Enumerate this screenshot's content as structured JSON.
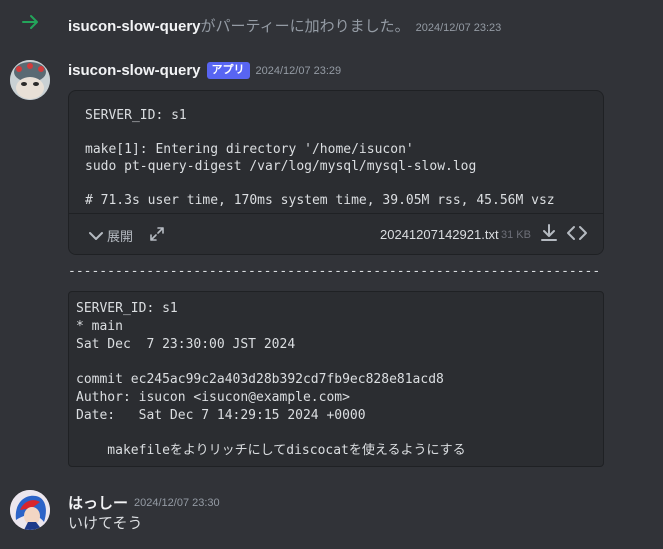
{
  "join_message": {
    "username": "isucon-slow-query",
    "text": "がパーティーに加わりました。",
    "timestamp": "2024/12/07 23:23"
  },
  "message1": {
    "author": "isucon-slow-query",
    "badge": "アプリ",
    "timestamp": "2024/12/07 23:29",
    "attachment": {
      "preview": "SERVER_ID: s1\n\nmake[1]: Entering directory '/home/isucon'\nsudo pt-query-digest /var/log/mysql/mysql-slow.log\n\n# 71.3s user time, 170ms system time, 39.05M rss, 45.56M vsz",
      "expand_label": "展開",
      "file_name": "20241207142921.txt",
      "file_size": "31 KB"
    },
    "separator": "--------------------------------------------------------------------",
    "code_block": "SERVER_ID: s1\n* main\nSat Dec  7 23:30:00 JST 2024\n\ncommit ec245ac99c2a403d28b392cd7fb9ec828e81acd8\nAuthor: isucon <isucon@example.com>\nDate:   Sat Dec 7 14:29:15 2024 +0000\n\n    makefileをよりリッチにしてdiscocatを使えるようにする"
  },
  "message2": {
    "author": "はっしー",
    "timestamp": "2024/12/07 23:30",
    "content": "いけてそう"
  },
  "icons": {
    "join": "arrow-right-icon",
    "expand": "chevron-down-icon",
    "fullscreen": "expand-arrows-icon",
    "download": "download-icon",
    "code": "code-icon"
  },
  "colors": {
    "background": "#313338",
    "embed_background": "#2b2d31",
    "join_arrow": "#23a55a",
    "app_badge": "#5865f2"
  }
}
